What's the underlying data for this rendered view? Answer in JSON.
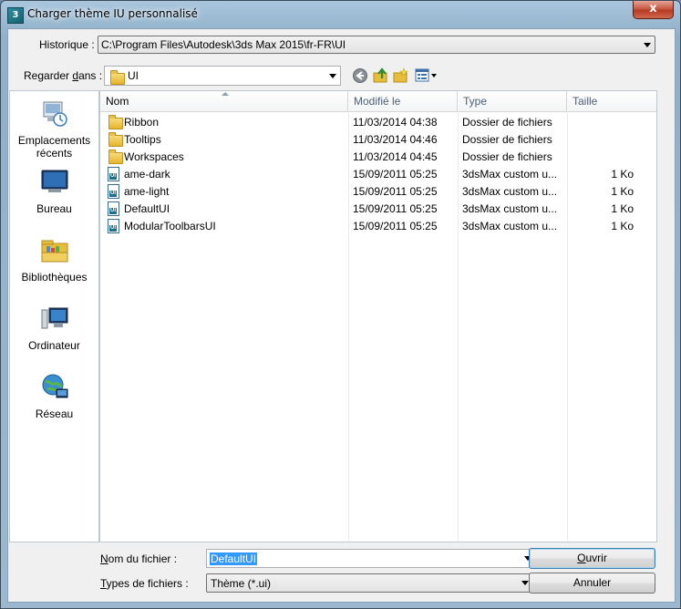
{
  "window": {
    "title": "Charger thème IU personnalisé",
    "close_glyph": "x",
    "app_icon_glyph": "3"
  },
  "history": {
    "label_prefix": "Historique",
    "label_suffix": " :",
    "value": "C:\\Program Files\\Autodesk\\3ds Max 2015\\fr-FR\\UI"
  },
  "look_in": {
    "label_prefix": "Regarder ",
    "label_u": "d",
    "label_suffix": "ans :",
    "value": "UI"
  },
  "places": [
    {
      "line1": "Emplacements",
      "line2": "récents",
      "icon": "recent-places-icon"
    },
    {
      "line1": "Bureau",
      "line2": "",
      "icon": "desktop-icon"
    },
    {
      "line1": "Bibliothèques",
      "line2": "",
      "icon": "libraries-icon"
    },
    {
      "line1": "Ordinateur",
      "line2": "",
      "icon": "computer-icon"
    },
    {
      "line1": "Réseau",
      "line2": "",
      "icon": "network-icon"
    }
  ],
  "columns": {
    "name": "Nom",
    "modified": "Modifié le",
    "type": "Type",
    "size": "Taille"
  },
  "files": [
    {
      "name": "Ribbon",
      "modified": "11/03/2014 04:38",
      "type": "Dossier de fichiers",
      "size": "",
      "kind": "folder"
    },
    {
      "name": "Tooltips",
      "modified": "11/03/2014 04:46",
      "type": "Dossier de fichiers",
      "size": "",
      "kind": "folder"
    },
    {
      "name": "Workspaces",
      "modified": "11/03/2014 04:45",
      "type": "Dossier de fichiers",
      "size": "",
      "kind": "folder"
    },
    {
      "name": "ame-dark",
      "modified": "15/09/2011 05:25",
      "type": "3dsMax custom u...",
      "size": "1 Ko",
      "kind": "file"
    },
    {
      "name": "ame-light",
      "modified": "15/09/2011 05:25",
      "type": "3dsMax custom u...",
      "size": "1 Ko",
      "kind": "file"
    },
    {
      "name": "DefaultUI",
      "modified": "15/09/2011 05:25",
      "type": "3dsMax custom u...",
      "size": "1 Ko",
      "kind": "file"
    },
    {
      "name": "ModularToolbarsUI",
      "modified": "15/09/2011 05:25",
      "type": "3dsMax custom u...",
      "size": "1 Ko",
      "kind": "file"
    }
  ],
  "filename": {
    "label_u": "N",
    "label_rest": "om du fichier :",
    "value": "DefaultUI"
  },
  "filetype": {
    "label_u": "T",
    "label_rest": "ypes de fichiers :",
    "value": "Thème (*.ui)"
  },
  "buttons": {
    "open_u": "O",
    "open_rest": "uvrir",
    "cancel": "Annuler"
  },
  "colors": {
    "selection": "#3399ff",
    "folder": "#e5b42c",
    "close": "#c85a45"
  }
}
